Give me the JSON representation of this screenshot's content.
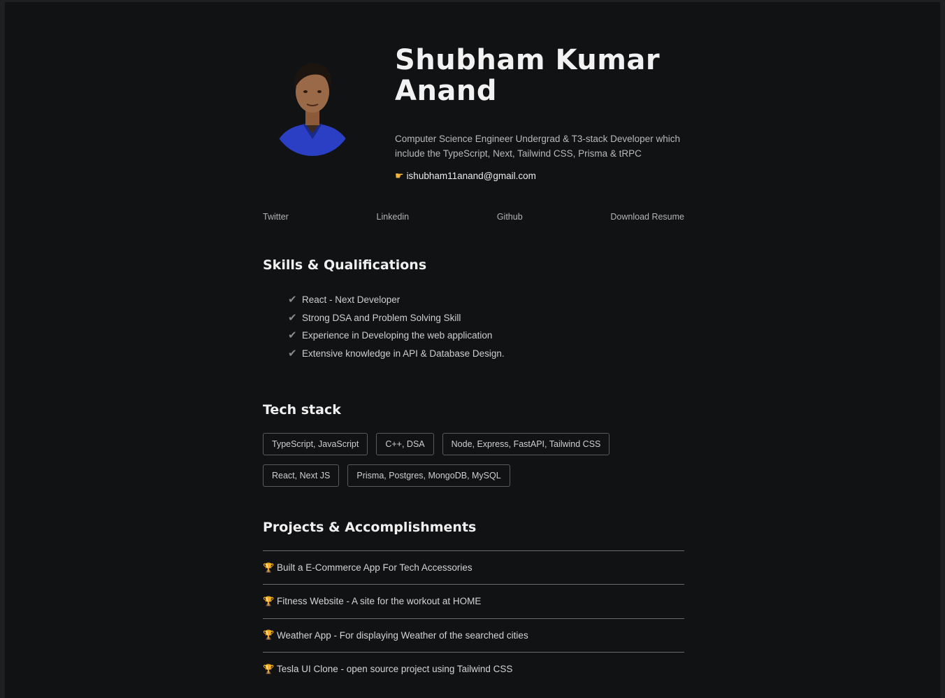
{
  "profile": {
    "name": "Shubham Kumar Anand",
    "bio": "Computer Science Engineer Undergrad & T3-stack Developer which include the TypeScript, Next, Tailwind CSS, Prisma & tRPC",
    "email": "ishubham11anand@gmail.com",
    "email_icon": "pointing-hand-icon"
  },
  "links": [
    "Twitter",
    "Linkedin",
    "Github",
    "Download Resume"
  ],
  "skills": {
    "title": "Skills & Qualifications",
    "items": [
      "React - Next Developer",
      "Strong DSA and Problem Solving Skill",
      "Experience in Developing the web application",
      "Extensive knowledge in API & Database Design."
    ]
  },
  "tech": {
    "title": "Tech stack",
    "items": [
      "TypeScript, JavaScript",
      "C++, DSA",
      "Node, Express, FastAPI, Tailwind CSS",
      "React, Next JS",
      "Prisma, Postgres, MongoDB, MySQL"
    ]
  },
  "projects": {
    "title": "Projects & Accomplishments",
    "items": [
      "Built a E-Commerce App For Tech Accessories",
      "Fitness Website - A site for the workout at HOME",
      "Weather App - For displaying Weather of the searched cities",
      "Tesla UI Clone - open source project using Tailwind CSS"
    ]
  },
  "colors": {
    "background": "#111214",
    "accent_trophy": "#e7a722",
    "shirt": "#2a3fc4"
  }
}
